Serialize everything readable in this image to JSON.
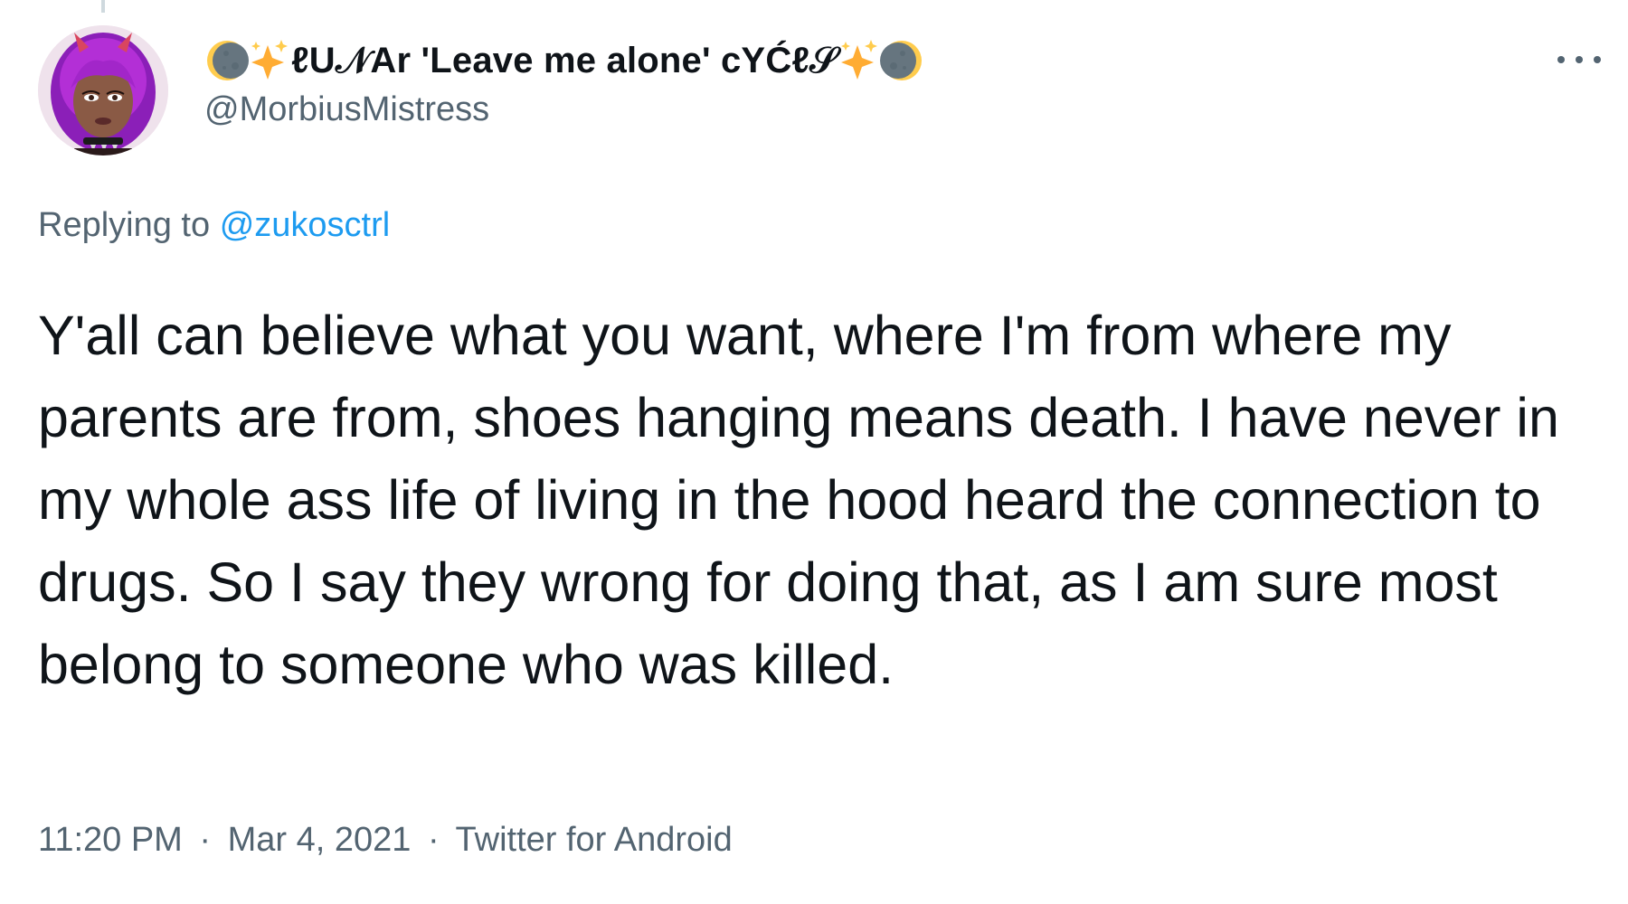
{
  "tweet": {
    "author": {
      "display_name": "ℓU𝒩Ar 'Leave me alone' cYĆℓ𝒮",
      "handle": "@MorbiusMistress",
      "name_emojis": [
        "crescent-moon-emoji",
        "sparkles-emoji",
        "sparkles-emoji",
        "crescent-moon-emoji"
      ]
    },
    "replying_prefix": "Replying to",
    "replying_to": "@zukosctrl",
    "text": "Y'all can believe what you want, where I'm from where my parents are from, shoes hanging means death. I have never in my whole ass life of living in the hood heard the connection to drugs. So I say they wrong for doing that, as I am sure most belong to someone who was killed.",
    "time": "11:20 PM",
    "date": "Mar 4, 2021",
    "source": "Twitter for Android",
    "separator": "·"
  },
  "icons": {
    "more": "more-options-icon",
    "avatar": "avatar"
  },
  "colors": {
    "text_primary": "#0f1419",
    "text_secondary": "#536471",
    "link": "#1d9bf0",
    "background": "#ffffff"
  }
}
